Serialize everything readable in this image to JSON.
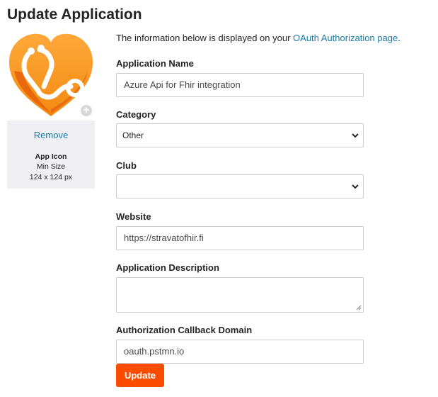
{
  "page": {
    "title": "Update Application"
  },
  "icon_panel": {
    "remove_label": "Remove",
    "icon_label": "App Icon",
    "min_size_label": "Min Size",
    "size_hint": "124 x 124 px",
    "add_glyph": "+"
  },
  "intro": {
    "text_before": "The information below is displayed on your ",
    "link_text": "OAuth Authorization page",
    "text_after": "."
  },
  "form": {
    "app_name": {
      "label": "Application Name",
      "value": "Azure Api for Fhir integration"
    },
    "category": {
      "label": "Category",
      "selected": "Other"
    },
    "club": {
      "label": "Club",
      "selected": ""
    },
    "website": {
      "label": "Website",
      "value": "https://stravatofhir.fi"
    },
    "description": {
      "label": "Application Description",
      "value": ""
    },
    "callback_domain": {
      "label": "Authorization Callback Domain",
      "value": "oauth.pstmn.io"
    },
    "submit_label": "Update"
  },
  "colors": {
    "accent": "#fc4c02",
    "link": "#1a7ba8",
    "icon_orange": "#f7941d",
    "icon_dark_orange": "#e8590c"
  },
  "icons": {
    "app_icon": "heart-stethoscope-icon",
    "chevron": "chevron-down-icon"
  }
}
